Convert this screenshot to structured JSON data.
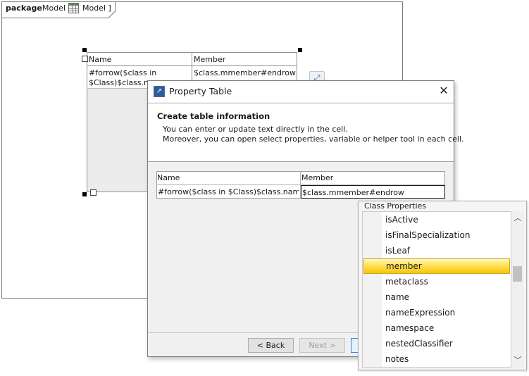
{
  "diagram": {
    "keyword": "package",
    "name_prefix": "Model [",
    "name_suffix": "Model ]",
    "table": {
      "headers": [
        "Name",
        "Member"
      ],
      "row": {
        "name_line1": "#forrow($class in",
        "name_line2": "$Class)$class.nam",
        "member": "$class.mmember#endrow"
      }
    }
  },
  "dialog": {
    "title": "Property Table",
    "close_glyph": "✕",
    "header": {
      "title": "Create table information",
      "line1": "You can enter or update text directly in the cell.",
      "line2": "Moreover, you can open select properties, variable or helper tool in each cell."
    },
    "table": {
      "headers": [
        "Name",
        "Member"
      ],
      "rows": [
        [
          "#forrow($class in $Class)$class.name",
          "$class.mmember#endrow"
        ]
      ]
    },
    "buttons": {
      "back": "< Back",
      "next": "Next >"
    }
  },
  "popup": {
    "title": "Class Properties",
    "items": [
      "isActive",
      "isFinalSpecialization",
      "isLeaf",
      "member",
      "metaclass",
      "name",
      "nameExpression",
      "namespace",
      "nestedClassifier",
      "notes"
    ],
    "selected": "member"
  },
  "colors": {
    "selection": "#ffd938",
    "accent": "#3c7fd3"
  }
}
